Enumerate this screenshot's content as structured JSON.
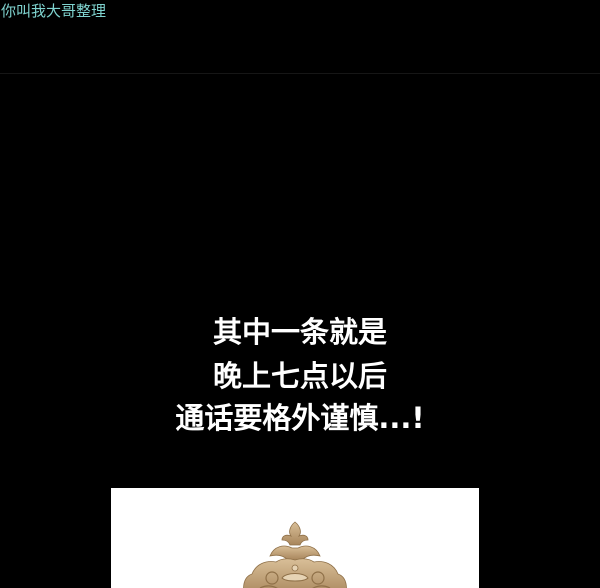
{
  "watermark": {
    "text": "你叫我大哥整理",
    "color": "#7fd3cf"
  },
  "caption": {
    "line1": "其中一条就是",
    "line2": "晚上七点以后",
    "line3": "通话要格外谨慎...!",
    "color": "#ffffff"
  },
  "colors": {
    "background": "#000000",
    "panel": "#ffffff",
    "ornament": "#c4a57f"
  },
  "panel": {
    "ornament_icon": "gilded-frame-ornament-icon"
  }
}
